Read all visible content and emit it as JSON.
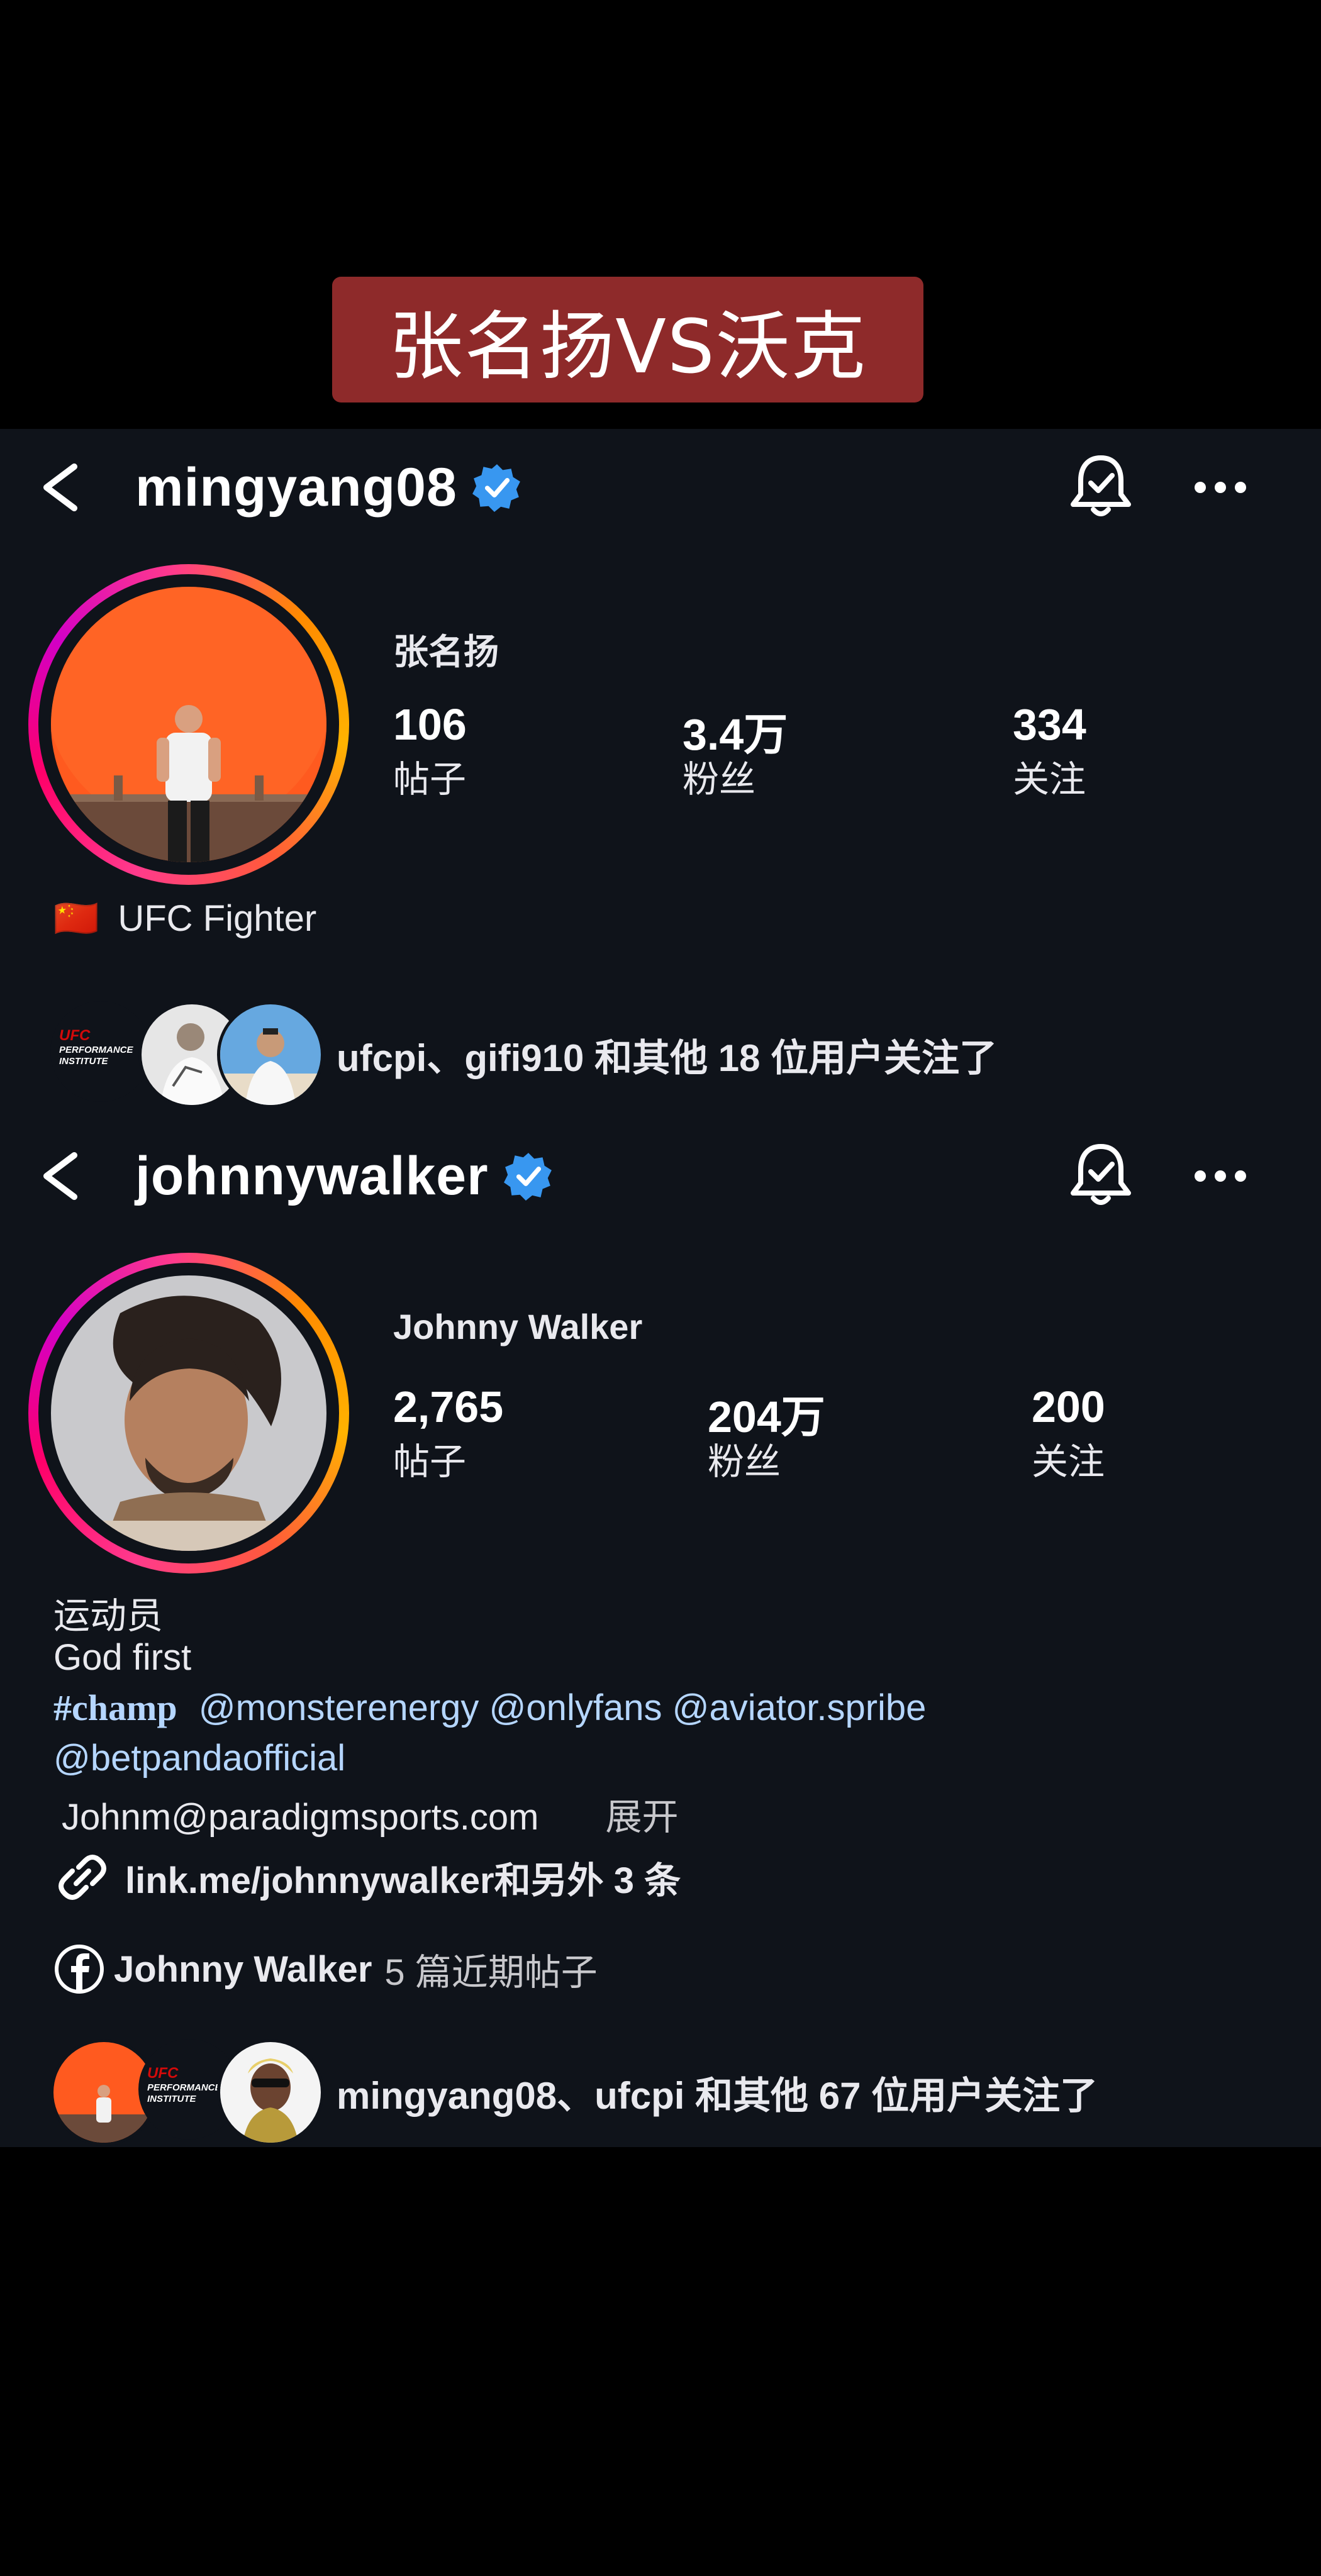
{
  "overlay": {
    "title": "张名扬VS沃克"
  },
  "profile1": {
    "username": "mingyang08",
    "full_name": "张名扬",
    "stats": [
      {
        "value": "106",
        "label": "帖子"
      },
      {
        "value": "3.4万",
        "label": "粉丝"
      },
      {
        "value": "334",
        "label": "关注"
      }
    ],
    "flag": "🇨🇳",
    "bio": "UFC Fighter",
    "ufcpi_logo": {
      "line1": "UFC",
      "line2": "PERFORMANCE",
      "line3": "INSTITUTE"
    },
    "followed_by": "ufcpi、gifi910 和其他 18 位用户关注了"
  },
  "profile2": {
    "username": "johnnywalker",
    "full_name": "Johnny Walker",
    "stats": [
      {
        "value": "2,765",
        "label": "帖子"
      },
      {
        "value": "204万",
        "label": "粉丝"
      },
      {
        "value": "200",
        "label": "关注"
      }
    ],
    "category": "运动员",
    "bio_line1": "God first",
    "hashtag": "#champ",
    "mentions_line1": "@monsterenergy @onlyfans  @aviator.spribe",
    "mentions_line2": "@betpandaofficial",
    "email": "Johnm@paradigmsports.com",
    "expand": "展开",
    "link_text": "link.me/johnnywalker和另外 3 条",
    "facebook_name": "Johnny Walker",
    "facebook_posts": "5 篇近期帖子",
    "ufcpi_logo": {
      "line1": "UFC",
      "line2": "PERFORMANCE",
      "line3": "INSTITUTE"
    },
    "followed_by": "mingyang08、ufcpi 和其他 67 位用户关注了"
  },
  "colors": {
    "background": "#000000",
    "screen": "#0f131a",
    "banner": "#8e2a2a",
    "verified": "#3897f0",
    "link": "#b5d6ff"
  },
  "icons": [
    "back-arrow-icon",
    "verified-badge-icon",
    "notification-bell-icon",
    "more-options-icon",
    "link-icon",
    "facebook-icon"
  ]
}
